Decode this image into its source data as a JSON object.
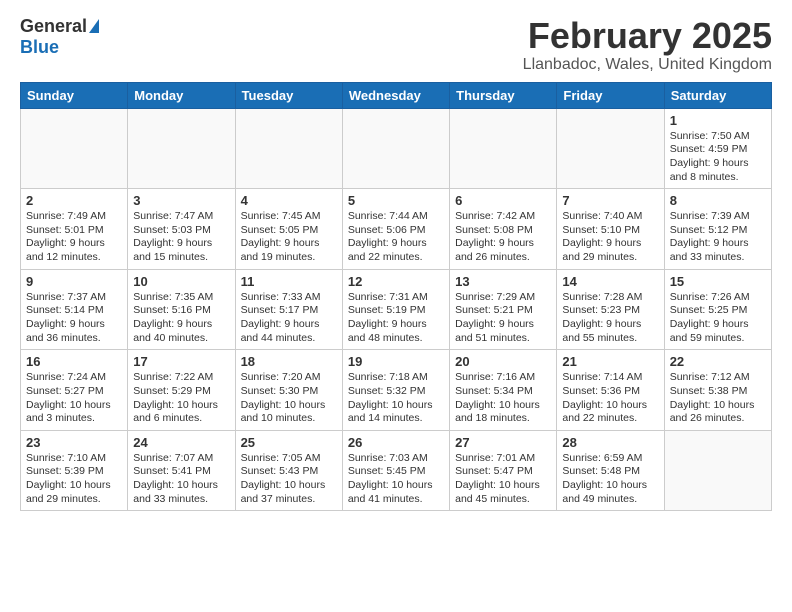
{
  "header": {
    "logo_general": "General",
    "logo_blue": "Blue",
    "month_title": "February 2025",
    "location": "Llanbadoc, Wales, United Kingdom"
  },
  "days_of_week": [
    "Sunday",
    "Monday",
    "Tuesday",
    "Wednesday",
    "Thursday",
    "Friday",
    "Saturday"
  ],
  "weeks": [
    [
      {
        "day": "",
        "info": ""
      },
      {
        "day": "",
        "info": ""
      },
      {
        "day": "",
        "info": ""
      },
      {
        "day": "",
        "info": ""
      },
      {
        "day": "",
        "info": ""
      },
      {
        "day": "",
        "info": ""
      },
      {
        "day": "1",
        "info": "Sunrise: 7:50 AM\nSunset: 4:59 PM\nDaylight: 9 hours and 8 minutes."
      }
    ],
    [
      {
        "day": "2",
        "info": "Sunrise: 7:49 AM\nSunset: 5:01 PM\nDaylight: 9 hours and 12 minutes."
      },
      {
        "day": "3",
        "info": "Sunrise: 7:47 AM\nSunset: 5:03 PM\nDaylight: 9 hours and 15 minutes."
      },
      {
        "day": "4",
        "info": "Sunrise: 7:45 AM\nSunset: 5:05 PM\nDaylight: 9 hours and 19 minutes."
      },
      {
        "day": "5",
        "info": "Sunrise: 7:44 AM\nSunset: 5:06 PM\nDaylight: 9 hours and 22 minutes."
      },
      {
        "day": "6",
        "info": "Sunrise: 7:42 AM\nSunset: 5:08 PM\nDaylight: 9 hours and 26 minutes."
      },
      {
        "day": "7",
        "info": "Sunrise: 7:40 AM\nSunset: 5:10 PM\nDaylight: 9 hours and 29 minutes."
      },
      {
        "day": "8",
        "info": "Sunrise: 7:39 AM\nSunset: 5:12 PM\nDaylight: 9 hours and 33 minutes."
      }
    ],
    [
      {
        "day": "9",
        "info": "Sunrise: 7:37 AM\nSunset: 5:14 PM\nDaylight: 9 hours and 36 minutes."
      },
      {
        "day": "10",
        "info": "Sunrise: 7:35 AM\nSunset: 5:16 PM\nDaylight: 9 hours and 40 minutes."
      },
      {
        "day": "11",
        "info": "Sunrise: 7:33 AM\nSunset: 5:17 PM\nDaylight: 9 hours and 44 minutes."
      },
      {
        "day": "12",
        "info": "Sunrise: 7:31 AM\nSunset: 5:19 PM\nDaylight: 9 hours and 48 minutes."
      },
      {
        "day": "13",
        "info": "Sunrise: 7:29 AM\nSunset: 5:21 PM\nDaylight: 9 hours and 51 minutes."
      },
      {
        "day": "14",
        "info": "Sunrise: 7:28 AM\nSunset: 5:23 PM\nDaylight: 9 hours and 55 minutes."
      },
      {
        "day": "15",
        "info": "Sunrise: 7:26 AM\nSunset: 5:25 PM\nDaylight: 9 hours and 59 minutes."
      }
    ],
    [
      {
        "day": "16",
        "info": "Sunrise: 7:24 AM\nSunset: 5:27 PM\nDaylight: 10 hours and 3 minutes."
      },
      {
        "day": "17",
        "info": "Sunrise: 7:22 AM\nSunset: 5:29 PM\nDaylight: 10 hours and 6 minutes."
      },
      {
        "day": "18",
        "info": "Sunrise: 7:20 AM\nSunset: 5:30 PM\nDaylight: 10 hours and 10 minutes."
      },
      {
        "day": "19",
        "info": "Sunrise: 7:18 AM\nSunset: 5:32 PM\nDaylight: 10 hours and 14 minutes."
      },
      {
        "day": "20",
        "info": "Sunrise: 7:16 AM\nSunset: 5:34 PM\nDaylight: 10 hours and 18 minutes."
      },
      {
        "day": "21",
        "info": "Sunrise: 7:14 AM\nSunset: 5:36 PM\nDaylight: 10 hours and 22 minutes."
      },
      {
        "day": "22",
        "info": "Sunrise: 7:12 AM\nSunset: 5:38 PM\nDaylight: 10 hours and 26 minutes."
      }
    ],
    [
      {
        "day": "23",
        "info": "Sunrise: 7:10 AM\nSunset: 5:39 PM\nDaylight: 10 hours and 29 minutes."
      },
      {
        "day": "24",
        "info": "Sunrise: 7:07 AM\nSunset: 5:41 PM\nDaylight: 10 hours and 33 minutes."
      },
      {
        "day": "25",
        "info": "Sunrise: 7:05 AM\nSunset: 5:43 PM\nDaylight: 10 hours and 37 minutes."
      },
      {
        "day": "26",
        "info": "Sunrise: 7:03 AM\nSunset: 5:45 PM\nDaylight: 10 hours and 41 minutes."
      },
      {
        "day": "27",
        "info": "Sunrise: 7:01 AM\nSunset: 5:47 PM\nDaylight: 10 hours and 45 minutes."
      },
      {
        "day": "28",
        "info": "Sunrise: 6:59 AM\nSunset: 5:48 PM\nDaylight: 10 hours and 49 minutes."
      },
      {
        "day": "",
        "info": ""
      }
    ]
  ]
}
